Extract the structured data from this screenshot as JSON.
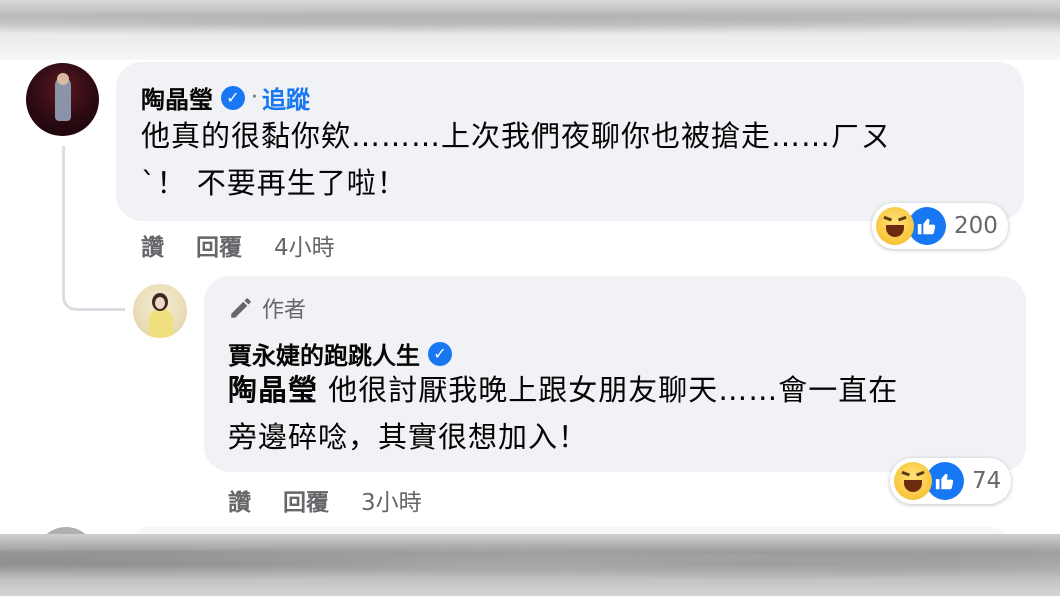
{
  "comment1": {
    "author": "陶晶瑩",
    "separator": "·",
    "follow_label": "追蹤",
    "text_line1": "他真的很黏你欸………上次我們夜聊你也被搶走……ㄏㄡ",
    "text_line2": "ˋ！ 不要再生了啦！",
    "actions": {
      "like": "讚",
      "reply": "回覆",
      "time": "4小時"
    },
    "reactions": {
      "types": [
        "haha-icon",
        "like-icon"
      ],
      "count": "200"
    }
  },
  "comment2": {
    "author_badge": "作者",
    "author": "賈永婕的跑跳人生",
    "mention": "陶晶瑩",
    "text_line1_rest": " 他很討厭我晚上跟女朋友聊天……會一直在",
    "text_line2": "旁邊碎唸，其實很想加入！",
    "actions": {
      "like": "讚",
      "reply": "回覆",
      "time": "3小時"
    },
    "reactions": {
      "types": [
        "haha-icon",
        "like-icon"
      ],
      "count": "74"
    }
  },
  "colors": {
    "bubble": "#f0f2f5",
    "link_blue": "#1877f2",
    "meta_gray": "#65676b"
  }
}
